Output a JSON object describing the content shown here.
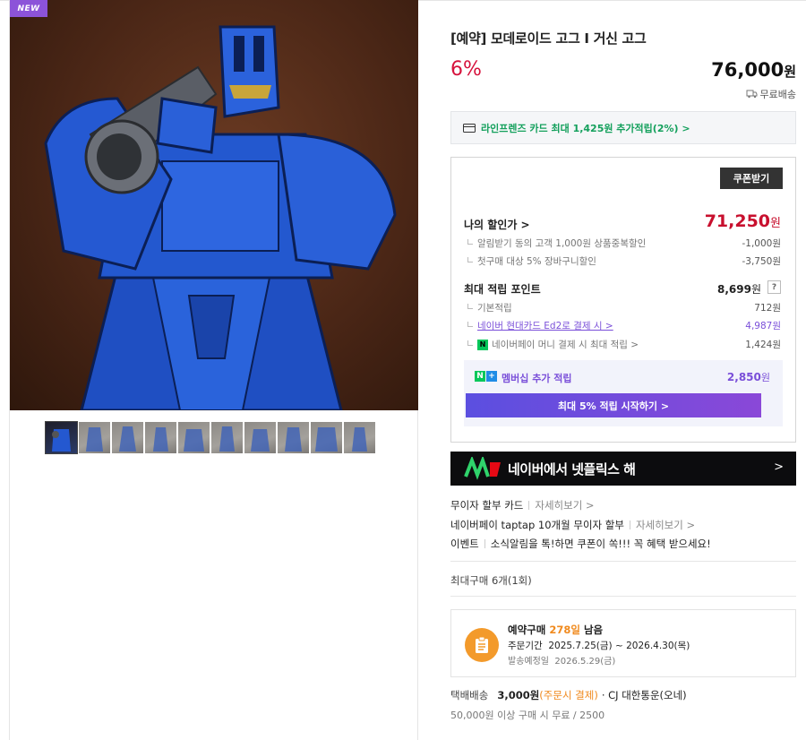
{
  "product": {
    "badge": "NEW",
    "title": "[예약] 모데로이드 고그 I 거신 고그",
    "discount_rate": "6%",
    "price": "76,000",
    "price_unit": "원",
    "shipping": "무료배송"
  },
  "card_promo": {
    "text": "라인프렌즈 카드 최대 1,425원 추가적립(2%) >"
  },
  "benefits": {
    "coupon_button": "쿠폰받기",
    "my_price_label": "나의 할인가 >",
    "my_price": "71,250",
    "my_price_unit": "원",
    "discounts": [
      {
        "label": "알림받기 동의 고객 1,000원 상품중복할인",
        "value": "-1,000원"
      },
      {
        "label": "첫구매 대상 5% 장바구니할인",
        "value": "-3,750원"
      }
    ],
    "points_label": "최대 적립 포인트",
    "points_value": "8,699",
    "points_unit": "원",
    "help": "?",
    "points": [
      {
        "label": "기본적립",
        "value": "712원"
      },
      {
        "label": "네이버 현대카드 Ed2로 결제 시 >",
        "value": "4,987원"
      },
      {
        "label": "네이버페이 머니 결제 시 최대 적립 >",
        "value": "1,424원"
      }
    ],
    "membership_label": "멤버십 추가 적립",
    "membership_value": "2,850",
    "membership_unit": "원",
    "membership_button": "최대 5% 적립 시작하기 >"
  },
  "banner": {
    "text": "네이버에서 넷플릭스 해",
    "arrow": ">"
  },
  "info": [
    {
      "text": "무이자 할부 카드",
      "more": "자세히보기 >"
    },
    {
      "text": "네이버페이 taptap 10개월 무이자 할부",
      "more": "자세히보기 >"
    },
    {
      "text": "이벤트",
      "more": "소식알림을 톡!하면 쿠폰이 쏙!!! 꼭 혜택 받으세요!"
    }
  ],
  "max_purchase": "최대구매 6개(1회)",
  "reservation": {
    "title_prefix": "예약구매",
    "days": "278일",
    "title_suffix": "남음",
    "period_label": "주문기간",
    "period": "2025.7.25(금) ~ 2026.4.30(목)",
    "ship_label": "발송예정일",
    "ship_date": "2026.5.29(금)"
  },
  "delivery": {
    "label": "택배배송",
    "amount": "3,000원",
    "note": "(주문시 결제)",
    "carrier": "· CJ 대한통운(오네)",
    "free_condition": "50,000원 이상 구매 시 무료 / 2500"
  }
}
